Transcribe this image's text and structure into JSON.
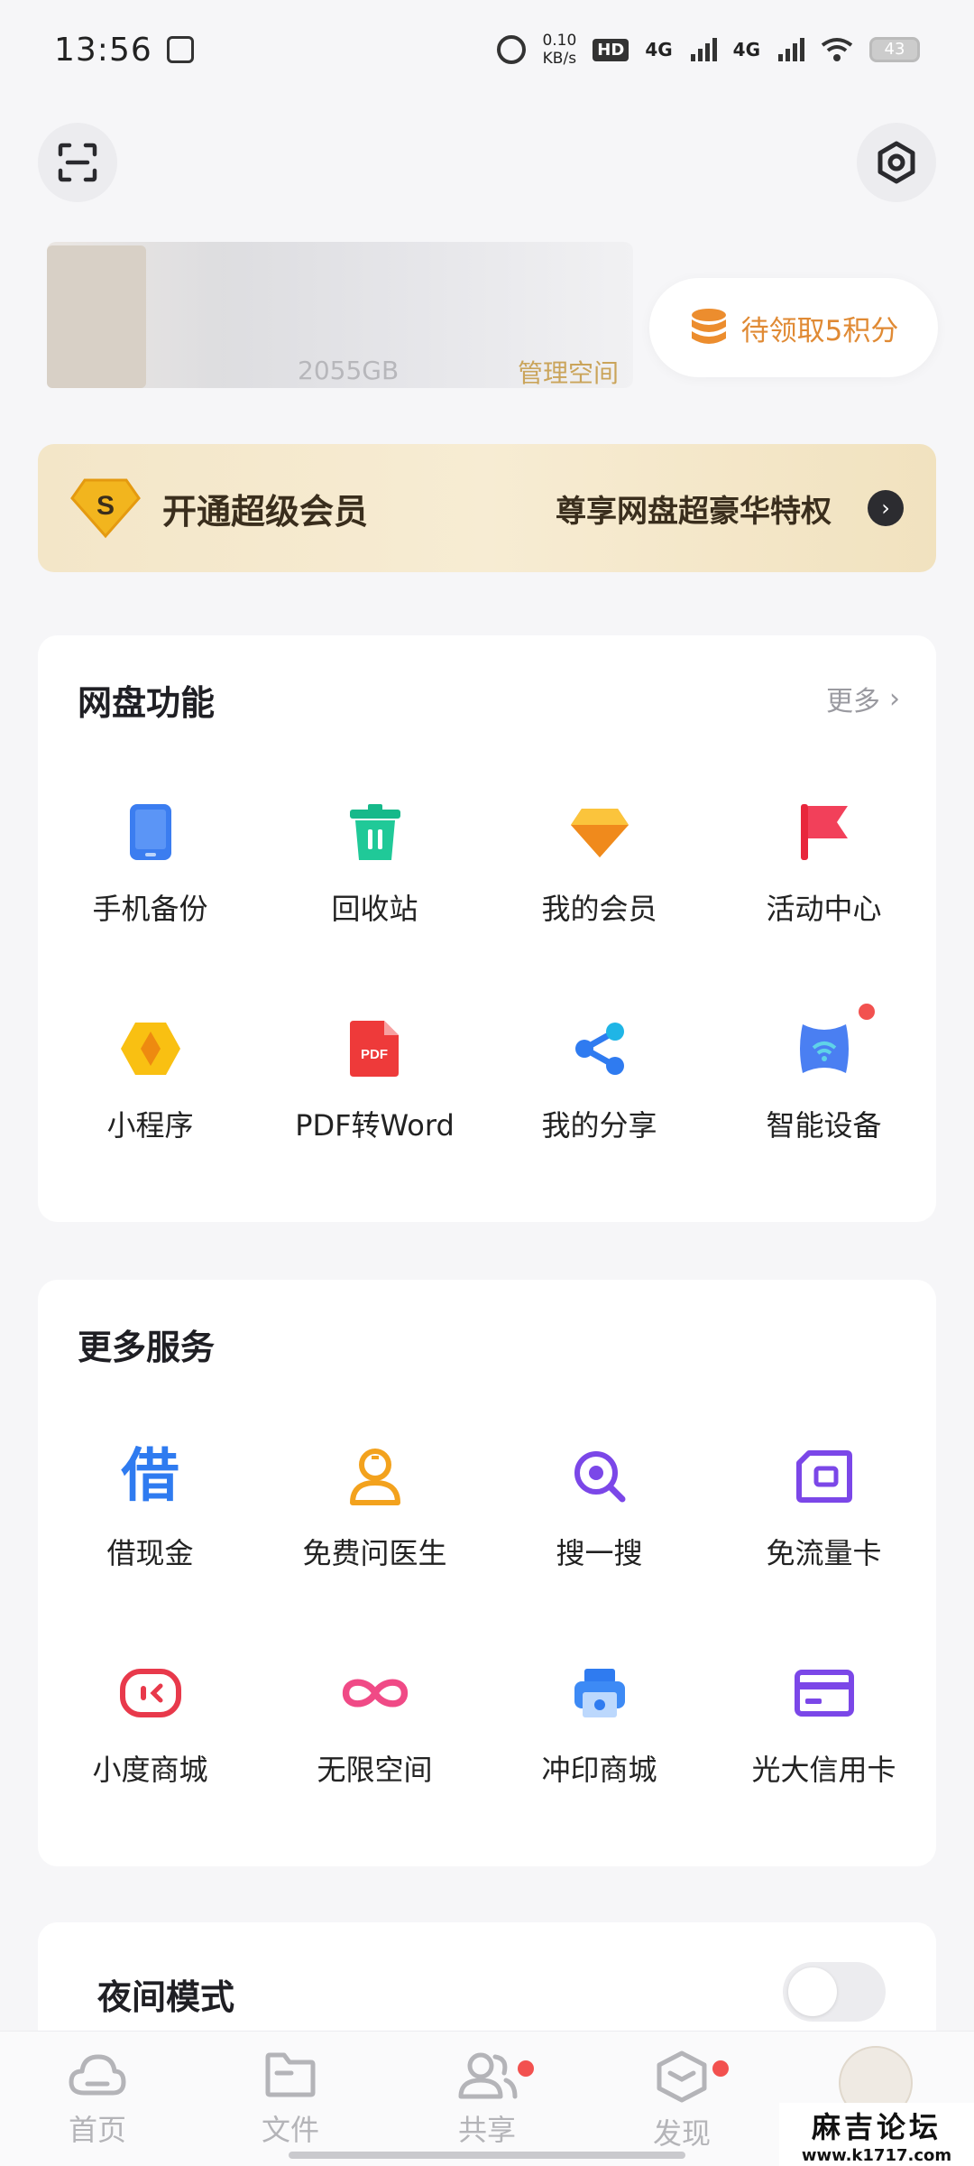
{
  "status_bar": {
    "time": "13:56",
    "net_speed_value": "0.10",
    "net_speed_unit": "KB/s",
    "hd": "HD",
    "net1": "4G",
    "net2": "4G",
    "battery": "43"
  },
  "profile": {
    "storage_text": "2055GB",
    "manage_space": "管理空间",
    "points_label": "待领取5积分"
  },
  "vip_banner": {
    "title": "开通超级会员",
    "subtitle": "尊享网盘超豪华特权",
    "badge_letter": "S"
  },
  "features": {
    "title": "网盘功能",
    "more": "更多",
    "items": [
      {
        "label": "手机备份",
        "icon": "phone-backup-icon"
      },
      {
        "label": "回收站",
        "icon": "recycle-bin-icon"
      },
      {
        "label": "我的会员",
        "icon": "diamond-icon"
      },
      {
        "label": "活动中心",
        "icon": "flag-icon"
      },
      {
        "label": "小程序",
        "icon": "mini-program-icon"
      },
      {
        "label": "PDF转Word",
        "icon": "pdf-icon",
        "icon_text": "PDF"
      },
      {
        "label": "我的分享",
        "icon": "share-icon"
      },
      {
        "label": "智能设备",
        "icon": "smart-device-icon",
        "badge": true
      }
    ]
  },
  "services": {
    "title": "更多服务",
    "items": [
      {
        "label": "借现金",
        "icon": "borrow-icon",
        "icon_text": "借"
      },
      {
        "label": "免费问医生",
        "icon": "doctor-icon"
      },
      {
        "label": "搜一搜",
        "icon": "search-icon"
      },
      {
        "label": "免流量卡",
        "icon": "sim-card-icon"
      },
      {
        "label": "小度商城",
        "icon": "xiaodu-icon"
      },
      {
        "label": "无限空间",
        "icon": "infinity-icon"
      },
      {
        "label": "冲印商城",
        "icon": "printer-icon"
      },
      {
        "label": "光大信用卡",
        "icon": "credit-card-icon"
      }
    ]
  },
  "night_mode": {
    "label": "夜间模式",
    "enabled": false
  },
  "bottom_nav": {
    "items": [
      {
        "label": "首页",
        "icon": "cloud-icon"
      },
      {
        "label": "文件",
        "icon": "folder-icon"
      },
      {
        "label": "共享",
        "icon": "people-icon",
        "badge": true
      },
      {
        "label": "发现",
        "icon": "cube-icon",
        "badge": true
      }
    ]
  },
  "watermark": {
    "title": "麻吉论坛",
    "url": "www.k1717.com"
  },
  "colors": {
    "accent_orange": "#e08a34",
    "vip_gold": "#f3e6c8",
    "badge_red": "#f2514f"
  }
}
